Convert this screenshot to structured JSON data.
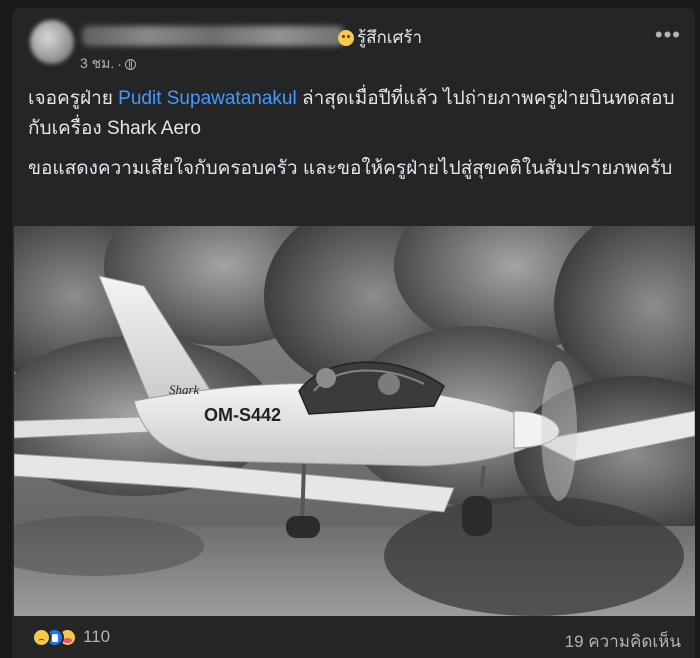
{
  "post": {
    "feeling": "รู้สึกเศร้า",
    "time": "3 ชม.",
    "separator": "·",
    "privacy_icon": "globe-icon",
    "more_icon": "more-options-icon",
    "more_label": "•••",
    "paragraph1": {
      "before": "เจอครูฝ่าย ",
      "mention": "Pudit Supawatanakul",
      "after": "  ล่าสุดเมื่อปีที่แล้ว ไปถ่ายภาพครูฝ่ายบินทดสอบกับเครื่อง Shark Aero"
    },
    "paragraph2": "ขอแสดงความเสียใจกับครอบครัว และขอให้ครูฝ่ายไปสู่สุขคติในสัมปรายภพครับ",
    "photo": {
      "tail_logo": "Shark",
      "registration": "OM-S442"
    }
  },
  "footer": {
    "reaction_icons": [
      "sad-reaction-icon",
      "like-reaction-icon",
      "care-reaction-icon"
    ],
    "reaction_count": "110",
    "comments": "19 ความคิดเห็น"
  },
  "colors": {
    "background": "#18191a",
    "card": "#242526",
    "text": "#e4e6eb",
    "secondary": "#b0b3b8",
    "link": "#4599ff"
  }
}
